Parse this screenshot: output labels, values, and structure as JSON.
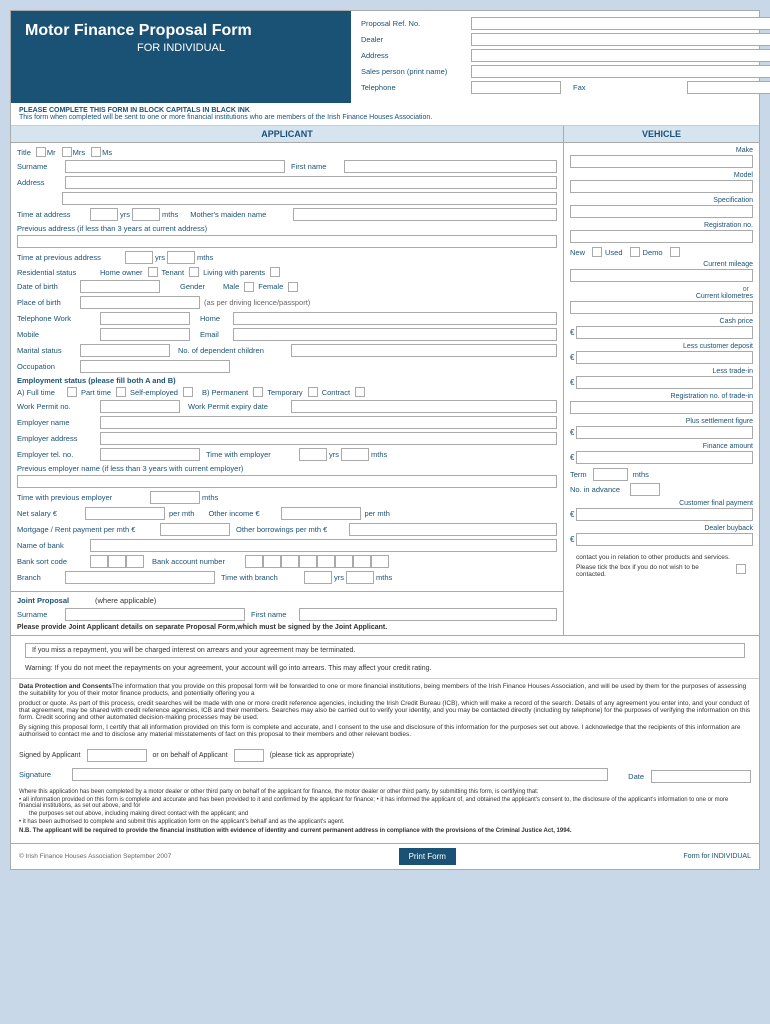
{
  "header": {
    "title_line1": "Motor Finance Proposal Form",
    "title_line2": "FOR INDIVIDUAL",
    "notice_bold": "PLEASE COMPLETE THIS FORM IN BLOCK CAPITALS IN BLACK INK",
    "notice_text": "This form when completed will be sent to one or more financial institutions who are members of the Irish Finance Houses Association."
  },
  "ref_fields": {
    "proposal_ref_label": "Proposal Ref. No.",
    "dealer_label": "Dealer",
    "address_label": "Address",
    "sales_label": "Sales person (print name)",
    "telephone_label": "Telephone",
    "fax_label": "Fax"
  },
  "applicant": {
    "section_label": "APPLICANT",
    "title_label": "Title",
    "mr_label": "Mr",
    "mrs_label": "Mrs",
    "ms_label": "Ms",
    "surname_label": "Surname",
    "first_name_label": "First name",
    "address_label": "Address",
    "time_at_address_label": "Time at address",
    "yrs_label": "yrs",
    "mths_label": "mths",
    "mothers_maiden_label": "Mother's maiden name",
    "prev_address_label": "Previous address (if less than 3 years at current address)",
    "time_at_prev_label": "Time at previous address",
    "residential_label": "Residential status",
    "home_owner_label": "Home owner",
    "tenant_label": "Tenant",
    "living_label": "Living with parents",
    "dob_label": "Date of birth",
    "gender_label": "Gender",
    "male_label": "Male",
    "female_label": "Female",
    "place_of_birth_label": "Place of birth",
    "driving_licence_label": "(as per driving licence/passport)",
    "telephone_work_label": "Telephone  Work",
    "home_label": "Home",
    "mobile_label": "Mobile",
    "email_label": "Email",
    "marital_label": "Marital status",
    "dependants_label": "No. of dependent children",
    "occupation_label": "Occupation",
    "employment_label": "Employment  status  (please  fill  both  A  and  B)",
    "full_time_label": "A) Full time",
    "part_time_label": "Part time",
    "self_employed_label": "Self-employed",
    "permanent_label": "B)  Permanent",
    "temporary_label": "Temporary",
    "contract_label": "Contract",
    "work_permit_label": "Work Permit no.",
    "work_permit_expiry_label": "Work Permit expiry date",
    "employer_name_label": "Employer name",
    "employer_address_label": "Employer address",
    "employer_tel_label": "Employer tel. no.",
    "time_with_employer_label": "Time with employer",
    "prev_employer_label": "Previous employer name (if less than 3 years with current employer)",
    "time_with_prev_label": "Time with previous employer",
    "net_salary_label": "Net salary €",
    "per_mth_label": "per mth",
    "other_income_label": "Other income €",
    "mortgage_label": "Mortgage / Rent payment per mth €",
    "other_borrowings_label": "Other borrowings per mth €",
    "bank_name_label": "Name of bank",
    "sort_code_label": "Bank sort code",
    "account_number_label": "Bank account number",
    "branch_label": "Branch",
    "time_with_branch_label": "Time with branch"
  },
  "vehicle": {
    "section_label": "VEHICLE",
    "make_label": "Make",
    "model_label": "Model",
    "specification_label": "Specification",
    "registration_label": "Registration no.",
    "new_label": "New",
    "used_label": "Used",
    "demo_label": "Demo",
    "current_mileage_label": "Current mileage",
    "or_label": "or",
    "current_km_label": "Current kilometres",
    "cash_price_label": "Cash price",
    "less_deposit_label": "Less customer deposit",
    "less_tradein_label": "Less trade-in",
    "reg_tradein_label": "Registration no. of trade-in",
    "settlement_label": "Plus settlement figure",
    "finance_amount_label": "Finance amount",
    "term_label": "Term",
    "mths_label": "mths",
    "no_advance_label": "No. in advance",
    "customer_final_label": "Customer final payment",
    "dealer_buyback_label": "Dealer buyback",
    "contact_text": "contact you in relation to other products and services.",
    "tick_text": "Please tick the box if you do not wish to be contacted."
  },
  "joint_proposal": {
    "label": "Joint  Proposal",
    "where_applicable": "(where applicable)",
    "surname_label": "Surname",
    "first_name_label": "First name",
    "separate_form_text": "Please provide Joint Applicant details on separate Proposal Form,which must be signed by the Joint Applicant."
  },
  "warnings": {
    "missed_payment": "If you miss a repayment, you will be charged interest on arrears and your agreement may be terminated.",
    "arrears": "Warning: If you do not meet the repayments on your agreement, your account will go into arrears. This may affect your credit rating."
  },
  "data_protection": {
    "title": "Data Protection and Consents",
    "text1": "The information that you provide on this proposal form will be forwarded to one or more financial institutions, being members of the Irish Finance Houses Association, and will be used by them for the purposes of assessing the suitability for you of their motor finance products, and potentially offering you a",
    "text2": "product or quote. As part of this process, credit searches will be made with one or more credit reference agencies, including the Irish Credit Bureau (ICB), which will make a record of the search. Details of any agreement you enter into, and your conduct of that agreement, may be shared with credit reference agencies, ICB and their members. Searches may also be carried out to verify your identity, and you may be contacted directly (including by telephone) for the purposes of verifying the information on this form. Credit scoring and other automated decision-making processes may be used.",
    "text3": "By signing this proposal form, I certify that all information provided on this form is complete and accurate, and I consent to the use and disclosure of this information for the purposes set out above. I acknowledge that the recipients of this information are authorised to contact me and to disclose any material misstatements of fact on this proposal to their members and other relevant bodies.",
    "signed_label": "Signed by Applicant",
    "on_behalf_label": "or on behalf of Applicant",
    "tick_label": "(please tick as appropriate)",
    "signature_label": "Signature",
    "date_label": "Date"
  },
  "dealer_cert": {
    "text": "Where this application has been completed by a motor dealer or other third party on behalf of the applicant for finance, the motor dealer or other third party, by submitting this form, is certifying that:",
    "bullet1": "• all information provided on this form is complete and accurate and has been provided to it and confirmed by the applicant for finance; • it has informed the applicant of, and obtained the applicant's consent to, the disclosure of the applicant's information to one or more financial institutions, as set out above, and for",
    "bullet2": "the purposes set out above, including making direct contact with the applicant; and",
    "bullet3": "• it has been authorised to complete and submit this application form on the applicant's behalf and as the applicant's agent.",
    "nb": "N.B. The applicant will be required to provide the financial institution with evidence of identity and current permanent address in compliance with the provisions of the Criminal Justice Act, 1994."
  },
  "footer": {
    "copyright": "© Irish Finance Houses Association September 2007",
    "print_label": "Print Form",
    "form_label": "Form for INDIVIDUAL"
  }
}
